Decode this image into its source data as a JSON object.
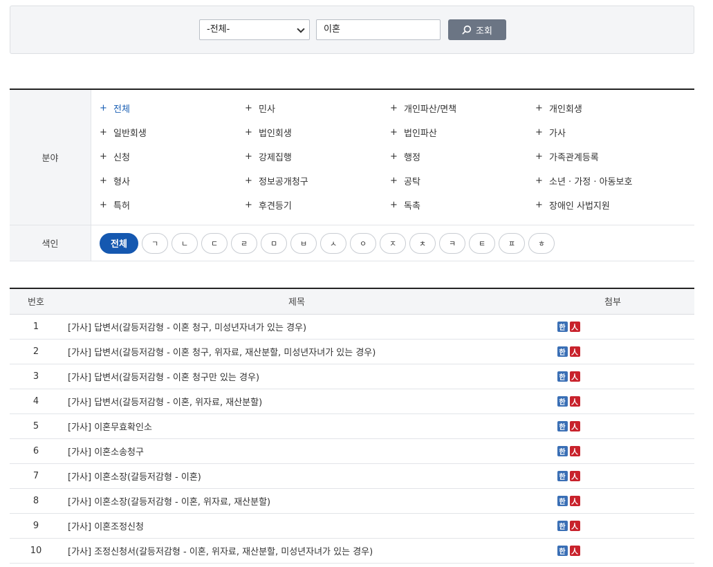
{
  "search": {
    "select_value": "-전체-",
    "query_value": "이혼",
    "button_label": "조회"
  },
  "filters": {
    "field_label": "분야",
    "fields": [
      {
        "label": "전체",
        "active": true
      },
      {
        "label": "민사"
      },
      {
        "label": "개인파산/면책"
      },
      {
        "label": "개인회생"
      },
      {
        "label": "일반회생"
      },
      {
        "label": "법인회생"
      },
      {
        "label": "법인파산"
      },
      {
        "label": "가사"
      },
      {
        "label": "신청"
      },
      {
        "label": "강제집행"
      },
      {
        "label": "행정"
      },
      {
        "label": "가족관계등록"
      },
      {
        "label": "형사"
      },
      {
        "label": "정보공개청구"
      },
      {
        "label": "공탁"
      },
      {
        "label": "소년 · 가정 · 아동보호"
      },
      {
        "label": "특허"
      },
      {
        "label": "후견등기"
      },
      {
        "label": "독촉"
      },
      {
        "label": "장애인 사법지원"
      }
    ],
    "plus_symbol": "+",
    "index_label": "색인",
    "index_all": "전체",
    "index_letters": [
      "ㄱ",
      "ㄴ",
      "ㄷ",
      "ㄹ",
      "ㅁ",
      "ㅂ",
      "ㅅ",
      "ㅇ",
      "ㅈ",
      "ㅊ",
      "ㅋ",
      "ㅌ",
      "ㅍ",
      "ㅎ"
    ]
  },
  "results": {
    "columns": {
      "num": "번호",
      "title": "제목",
      "attach": "첨부"
    },
    "hwp_glyph": "한",
    "pdf_glyph": "人",
    "rows": [
      {
        "num": "1",
        "title": "[가사] 답변서(갈등저감형 - 이혼 청구, 미성년자녀가 있는 경우)"
      },
      {
        "num": "2",
        "title": "[가사] 답변서(갈등저감형 - 이혼 청구, 위자료, 재산분할, 미성년자녀가 있는 경우)"
      },
      {
        "num": "3",
        "title": "[가사] 답변서(갈등저감형 - 이혼 청구만 있는 경우)"
      },
      {
        "num": "4",
        "title": "[가사] 답변서(갈등저감형 - 이혼, 위자료, 재산분할)"
      },
      {
        "num": "5",
        "title": "[가사] 이혼무효확인소"
      },
      {
        "num": "6",
        "title": "[가사] 이혼소송청구"
      },
      {
        "num": "7",
        "title": "[가사] 이혼소장(갈등저감형 - 이혼)"
      },
      {
        "num": "8",
        "title": "[가사] 이혼소장(갈등저감형 - 이혼, 위자료, 재산분할)"
      },
      {
        "num": "9",
        "title": "[가사] 이혼조정신청"
      },
      {
        "num": "10",
        "title": "[가사] 조정신청서(갈등저감형 - 이혼, 위자료, 재산분할, 미성년자녀가 있는 경우)"
      }
    ]
  },
  "colors": {
    "accent": "#1558b0",
    "button_gray": "#6b7584",
    "hwp": "#3a6fb5",
    "pdf": "#c8222c"
  }
}
